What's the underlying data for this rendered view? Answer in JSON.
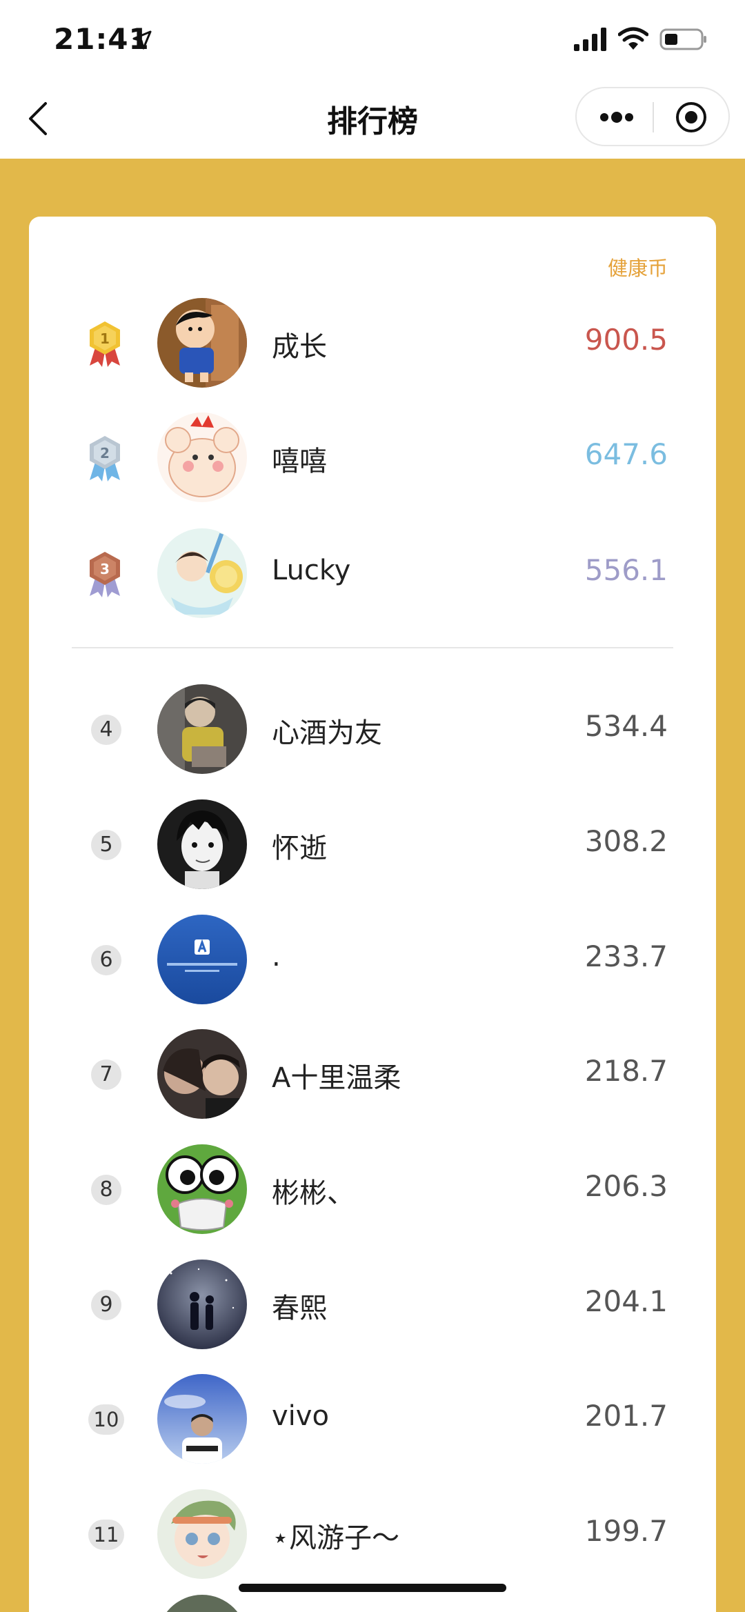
{
  "status_bar": {
    "time": "21:41"
  },
  "nav": {
    "title": "排行榜"
  },
  "leaderboard": {
    "column_header": "健康币",
    "colors": {
      "gold": "#c9564e",
      "silver": "#7bbde0",
      "bronze": "#9e9cc8",
      "regular": "#555555",
      "header": "#e5a23a",
      "background": "#e2b84a"
    },
    "top": [
      {
        "rank": "1",
        "name": "成长",
        "score": "900.5",
        "badge": "gold-medal-icon"
      },
      {
        "rank": "2",
        "name": "嘻嘻",
        "score": "647.6",
        "badge": "silver-medal-icon"
      },
      {
        "rank": "3",
        "name": "Lucky",
        "score": "556.1",
        "badge": "bronze-medal-icon"
      }
    ],
    "rest": [
      {
        "rank": "4",
        "name": "心酒为友",
        "score": "534.4"
      },
      {
        "rank": "5",
        "name": "怀逝",
        "score": "308.2"
      },
      {
        "rank": "6",
        "name": ".",
        "score": "233.7"
      },
      {
        "rank": "7",
        "name": "A十里温柔",
        "score": "218.7"
      },
      {
        "rank": "8",
        "name": "彬彬、",
        "score": "206.3"
      },
      {
        "rank": "9",
        "name": "春熙",
        "score": "204.1"
      },
      {
        "rank": "10",
        "name": "vivo",
        "score": "201.7"
      },
      {
        "rank": "11",
        "name": "⋆风游子～",
        "score": "199.7"
      }
    ]
  }
}
